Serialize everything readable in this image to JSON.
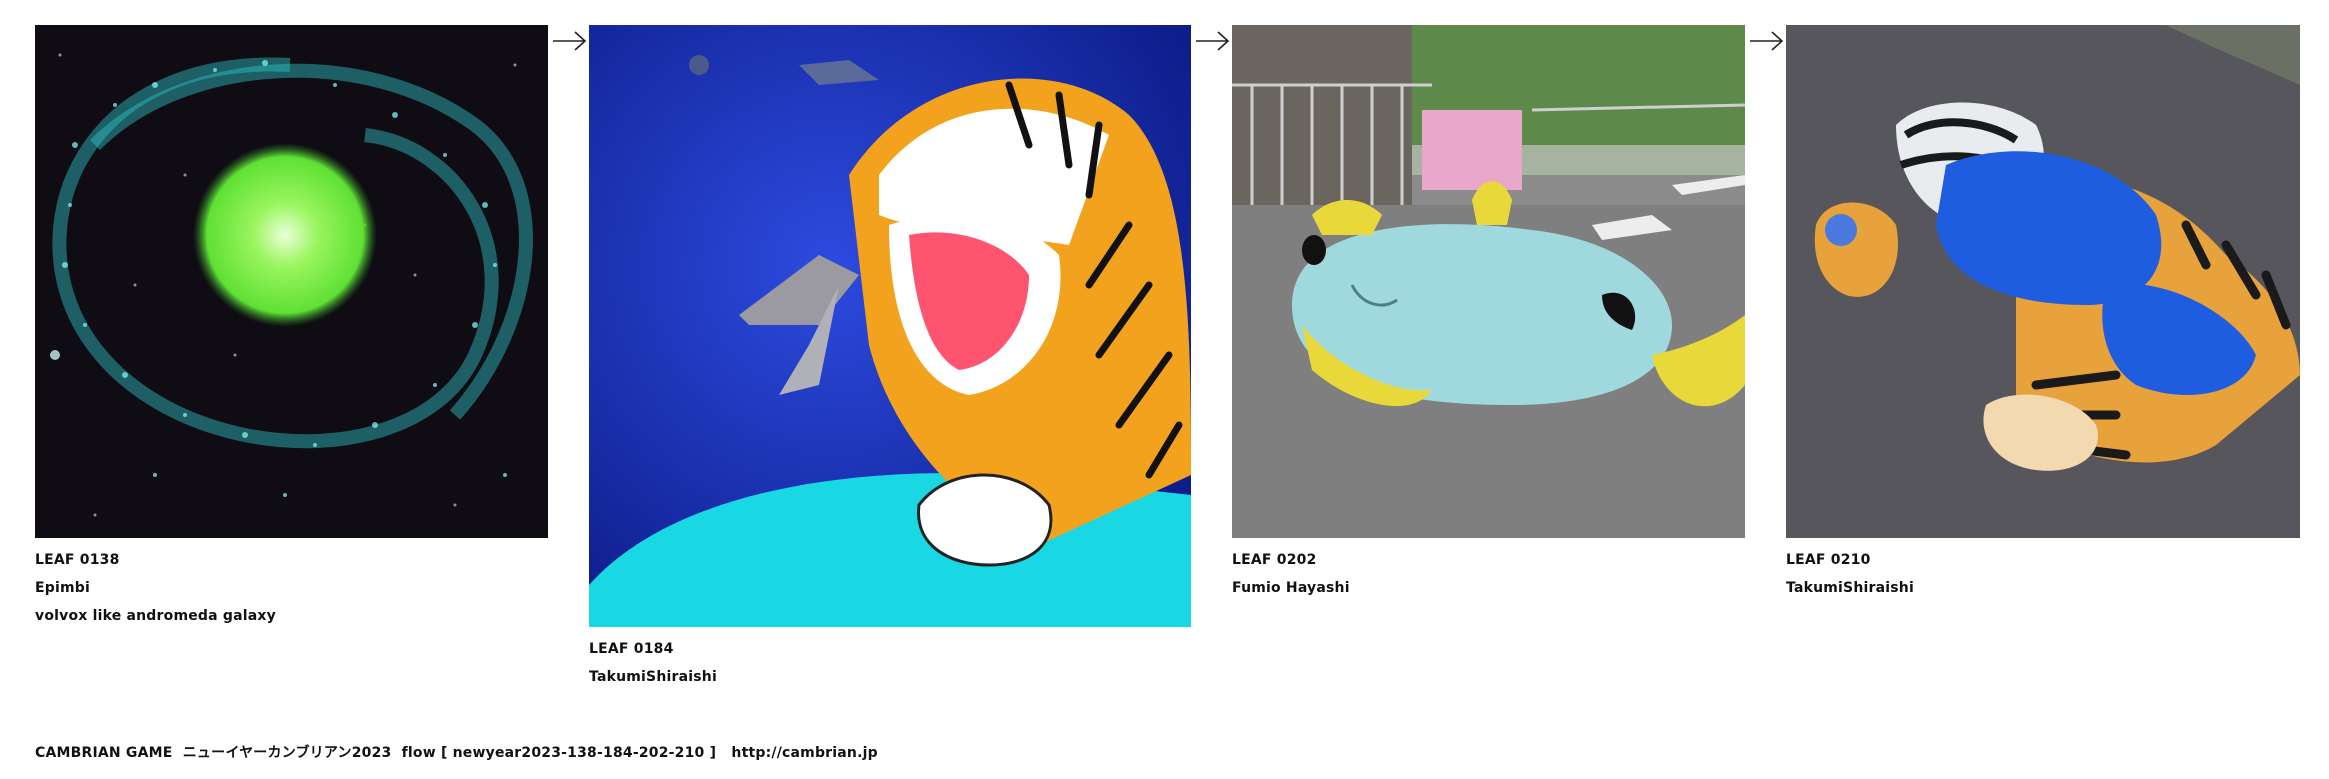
{
  "leaves": [
    {
      "leaf_id": "LEAF 0138",
      "author": "Epimbi",
      "caption": "volvox like andromeda galaxy",
      "image_subject": "green glowing sphere at the center of a teal spiral galaxy"
    },
    {
      "leaf_id": "LEAF 0184",
      "author": "TakumiShiraishi",
      "caption": "",
      "image_subject": "painted roaring tiger eating a fish on a blue background"
    },
    {
      "leaf_id": "LEAF 0202",
      "author": "Fumio Hayashi",
      "caption": "",
      "image_subject": "large knitted light-blue fish plush lying on a street"
    },
    {
      "leaf_id": "LEAF 0210",
      "author": "TakumiShiraishi",
      "caption": "",
      "image_subject": "tiger plush with blue fur lying on asphalt"
    }
  ],
  "arrow_icon": "right-arrow-icon",
  "footer": {
    "game": "CAMBRIAN GAME",
    "title": "ニューイヤーカンブリアン2023",
    "flow": "flow [ newyear2023-138-184-202-210 ]",
    "url": "http://cambrian.jp"
  },
  "colors": {
    "background": "#ffffff",
    "text": "#111111",
    "galaxy_glow": "#7cf04a",
    "galaxy_spiral": "#3fd6d6",
    "tiger_orange": "#f3a21e",
    "painting_blue": "#1f3fc8",
    "painting_cyan": "#19d7e3",
    "plush_blue": "#9fd9dd",
    "plush_yellow": "#e8d83a",
    "fur_blue": "#1f5de0"
  }
}
